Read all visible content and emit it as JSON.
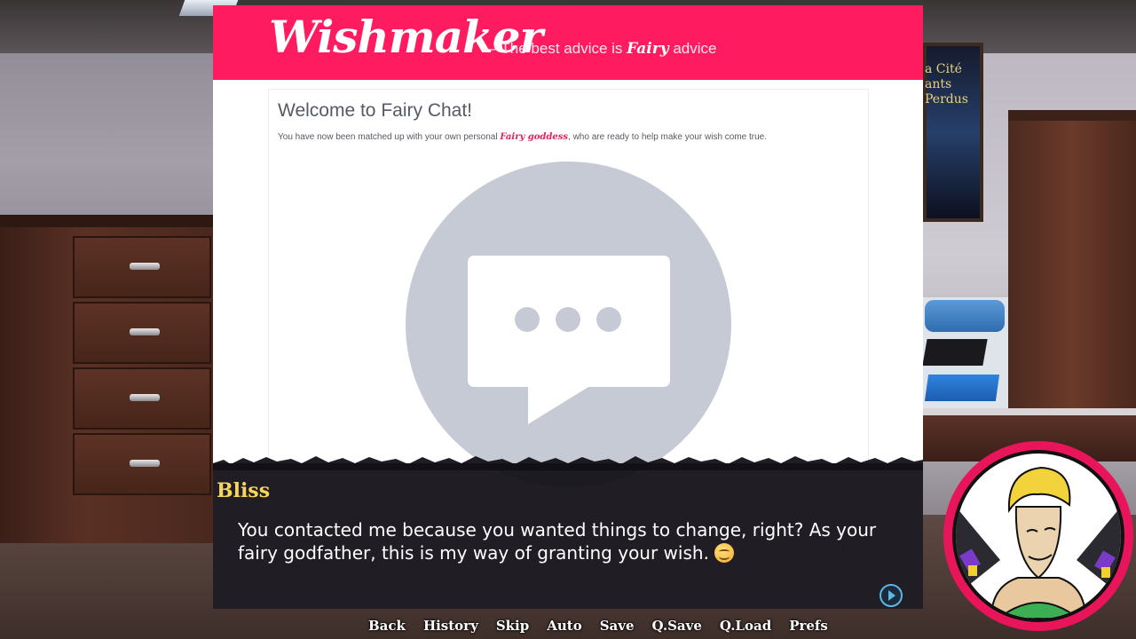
{
  "site": {
    "logo": "Wishmaker",
    "tagline_prefix": "— The best advice is ",
    "tagline_accent": "Fairy",
    "tagline_suffix": " advice",
    "brand_color": "#ff1b5f"
  },
  "chat_card": {
    "title": "Welcome to Fairy Chat!",
    "text_prefix": "You have now been matched up with your own personal ",
    "text_accent": "Fairy goddess",
    "text_suffix": ", who are ready to help make your wish come true.",
    "placeholder_icon": "chat-bubble-icon"
  },
  "background": {
    "poster_text": "a Cité\nants Perdus"
  },
  "dialogue": {
    "speaker": "Bliss",
    "text": "You contacted me because you wanted things to change, right? As your fairy godfather, this is my way of granting your wish.",
    "emoji": "smile-emoji",
    "speaker_color": "#f6d65a"
  },
  "quick_menu": {
    "items": [
      "Back",
      "History",
      "Skip",
      "Auto",
      "Save",
      "Q.Save",
      "Q.Load",
      "Prefs"
    ]
  },
  "portrait": {
    "character": "Bliss",
    "ring_color": "#e8155a"
  }
}
